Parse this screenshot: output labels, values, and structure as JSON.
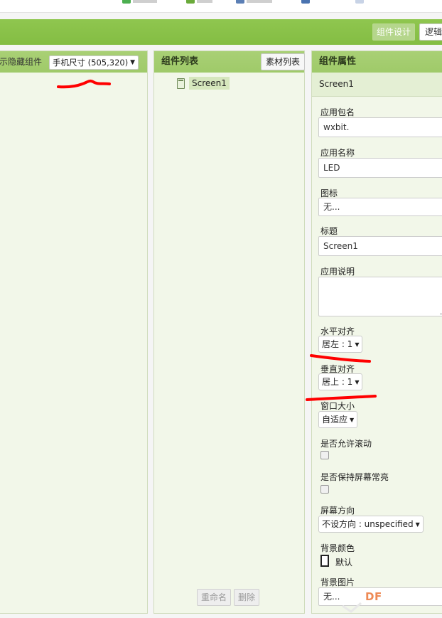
{
  "toolbar": {
    "design_label": "组件设计",
    "logic_label": "逻辑",
    "colors": {
      "bar": "#8bc34a",
      "design_button": "#b5d68c"
    }
  },
  "viewer": {
    "hidden_components_label": "示隐藏组件",
    "device_size": "手机尺寸 (505,320)"
  },
  "components": {
    "title": "组件列表",
    "assets_button": "素材列表",
    "tree": [
      {
        "label": "Screen1",
        "icon": "screen-icon"
      }
    ],
    "rename_button": "重命名",
    "delete_button": "删除"
  },
  "properties": {
    "title": "组件属性",
    "selected_component": "Screen1",
    "app_package_label": "应用包名",
    "app_package_value": "wxbit.",
    "app_name_label": "应用名称",
    "app_name_value": "LED",
    "icon_label": "图标",
    "icon_value": "无...",
    "title_label": "标题",
    "title_value": "Screen1",
    "description_label": "应用说明",
    "description_value": "",
    "align_h_label": "水平对齐",
    "align_h_value": "居左 : 1",
    "align_v_label": "垂直对齐",
    "align_v_value": "居上 : 1",
    "window_size_label": "窗口大小",
    "window_size_value": "自适应",
    "scrollable_label": "是否允许滚动",
    "scrollable_checked": false,
    "keep_screen_on_label": "是否保持屏幕常亮",
    "keep_screen_on_checked": false,
    "orientation_label": "屏幕方向",
    "orientation_value": "不设方向 : unspecified",
    "bg_color_label": "背景颜色",
    "bg_color_value": "默认",
    "bg_image_label": "背景图片",
    "bg_image_value": "无..."
  },
  "annotation": {
    "color": "#ff0000"
  },
  "watermark": {
    "text": "DF"
  }
}
